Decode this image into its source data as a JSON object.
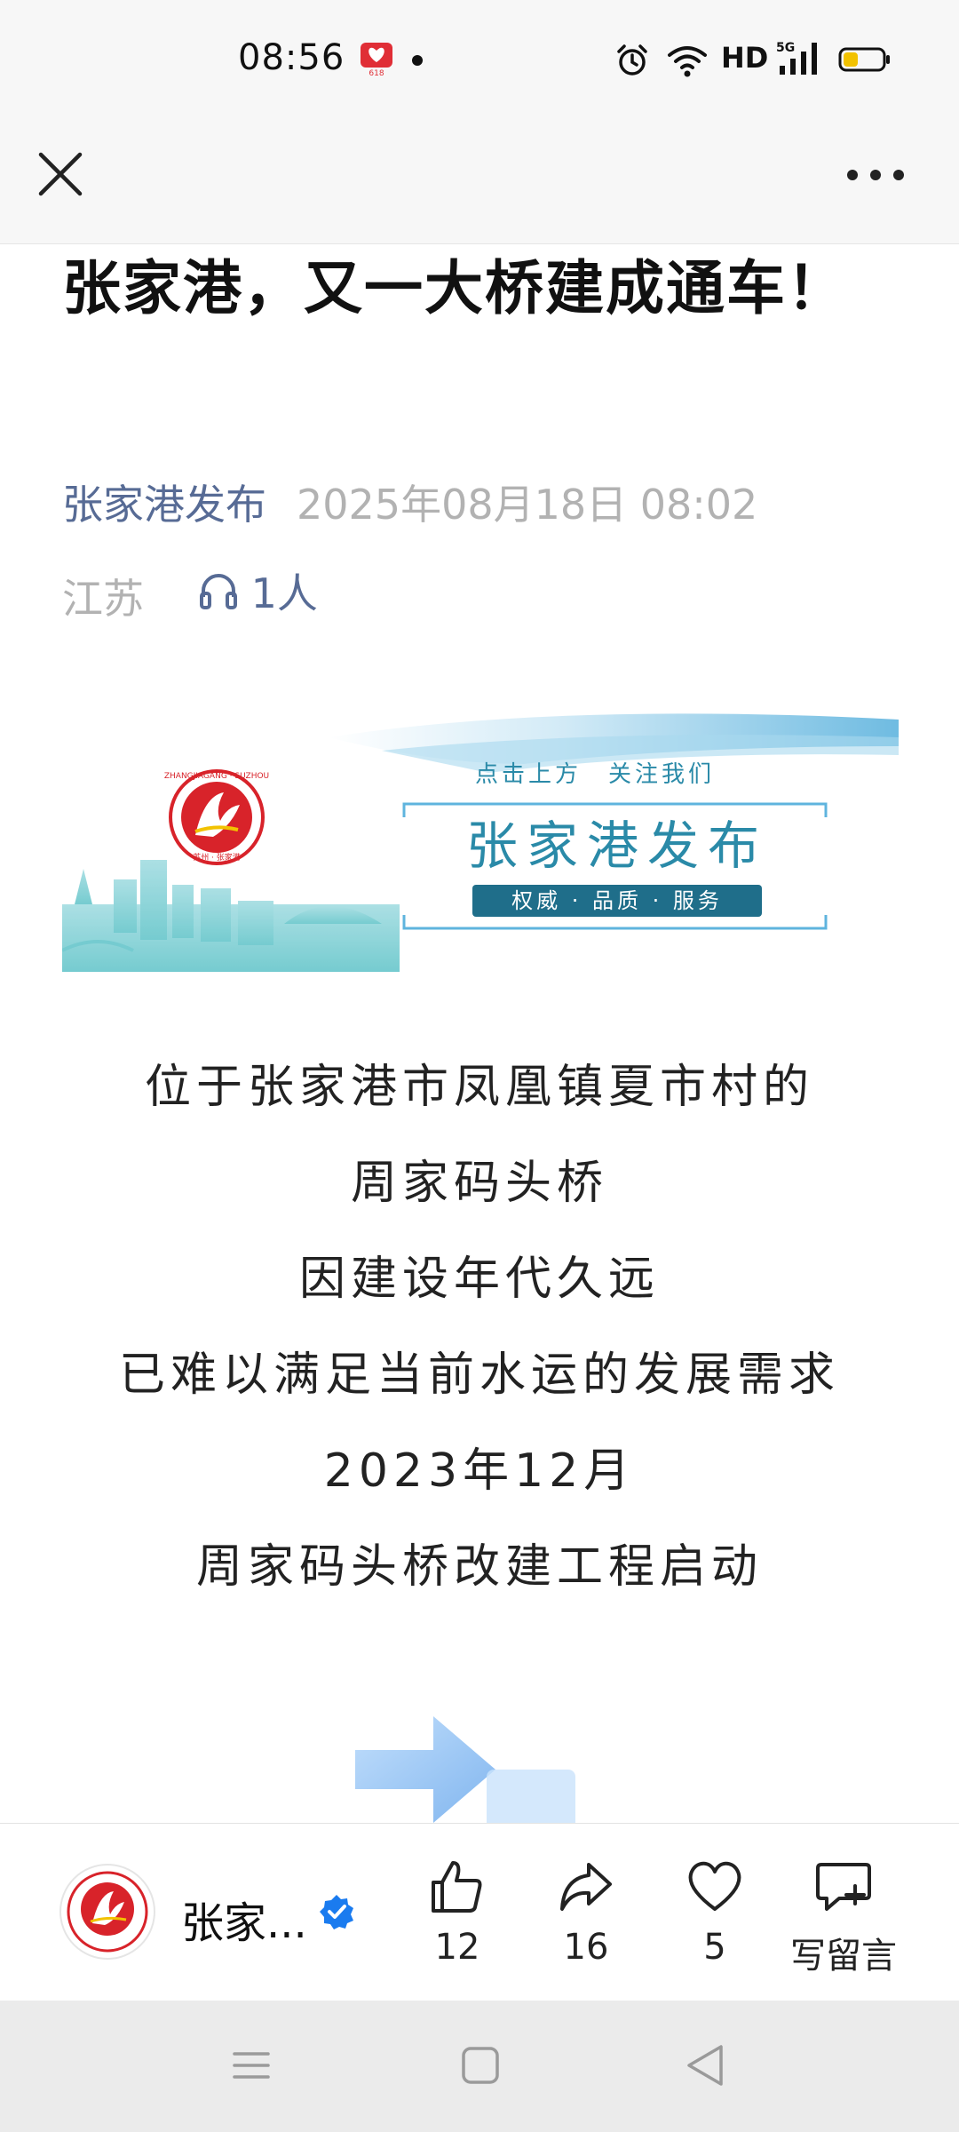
{
  "status_bar": {
    "time": "08:56",
    "network": "HD",
    "signal": "5G",
    "badge_text": "618"
  },
  "nav": {
    "close_icon": "close-icon",
    "more_icon": "more-icon"
  },
  "article": {
    "title": "张家港，又一大桥建成通车！",
    "author": "张家港发布",
    "date": "2025年08月18日 08:02",
    "region": "江苏",
    "listeners": "1人"
  },
  "banner": {
    "top_text": "点击上方　关注我们",
    "name": "张家港发布",
    "slogan": "权威 · 品质 · 服务",
    "logo_text": "ZHANGJIAGANG · SUZHOU",
    "logo_sub": "苏州 · 张家港"
  },
  "content": {
    "lines": [
      "位于张家港市凤凰镇夏市村的",
      "周家码头桥",
      "因建设年代久远",
      "已难以满足当前水运的发展需求",
      "2023年12月",
      "周家码头桥改建工程启动"
    ]
  },
  "action_bar": {
    "account_name": "张家...",
    "like_count": "12",
    "share_count": "16",
    "fav_count": "5",
    "comment_label": "写留言"
  },
  "colors": {
    "link": "#576b95",
    "meta_gray": "#b2b2b2",
    "verified": "#1a7bef",
    "brand_red": "#d8232a",
    "banner_teal": "#2a8aa8"
  }
}
